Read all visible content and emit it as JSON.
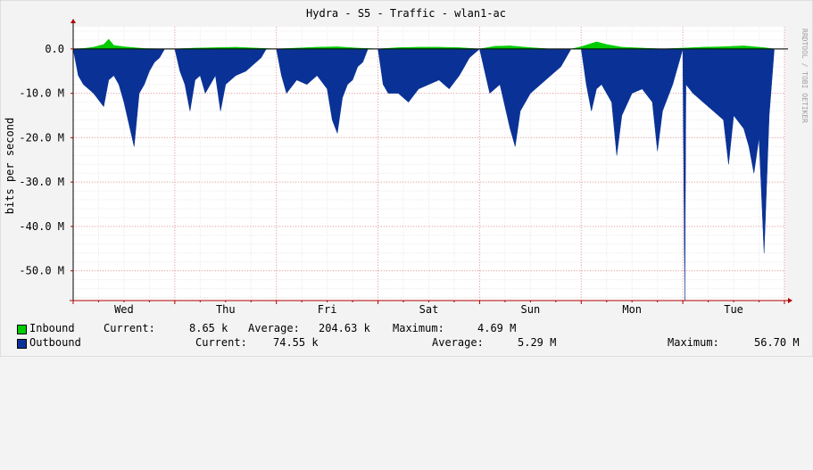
{
  "chart_data": {
    "type": "area",
    "title": "Hydra - S5 - Traffic - wlan1-ac",
    "ylabel": "bits per second",
    "watermark": "RRDTOOL / TOBI OETIKER",
    "x_ticks": [
      "Wed",
      "Thu",
      "Fri",
      "Sat",
      "Sun",
      "Mon",
      "Tue"
    ],
    "x_range_days": [
      0,
      7
    ],
    "y_ticks": [
      {
        "value": 0,
        "label": "0.0"
      },
      {
        "value": -10,
        "label": "-10.0 M"
      },
      {
        "value": -20,
        "label": "-20.0 M"
      },
      {
        "value": -30,
        "label": "-30.0 M"
      },
      {
        "value": -40,
        "label": "-40.0 M"
      },
      {
        "value": -50,
        "label": "-50.0 M"
      }
    ],
    "y_unit": "M",
    "ylim": [
      -56.7,
      5
    ],
    "grid": true,
    "colors": {
      "inbound": "#00cc00",
      "outbound": "#0a3296",
      "grid_minor": "#ececec",
      "grid_major": "#f0a0a0",
      "axis": "#b00000",
      "plot_bg": "#ffffff",
      "page_bg": "#f3f3f3"
    },
    "series": [
      {
        "name": "Inbound",
        "x": [
          0.0,
          0.1,
          0.2,
          0.3,
          0.35,
          0.4,
          0.5,
          0.6,
          0.7,
          0.9,
          1.0,
          1.2,
          1.4,
          1.6,
          1.8,
          2.0,
          2.2,
          2.4,
          2.6,
          2.8,
          3.0,
          3.2,
          3.4,
          3.6,
          3.8,
          4.0,
          4.15,
          4.3,
          4.5,
          4.7,
          4.9,
          5.0,
          5.15,
          5.25,
          5.4,
          5.6,
          5.8,
          6.0,
          6.2,
          6.4,
          6.6,
          6.8,
          6.9,
          7.0
        ],
        "values": [
          0,
          0.1,
          0.4,
          1.0,
          2.2,
          0.8,
          0.5,
          0.3,
          0.1,
          0,
          0,
          0.2,
          0.3,
          0.4,
          0.2,
          0,
          0.2,
          0.4,
          0.5,
          0.2,
          0,
          0.3,
          0.4,
          0.4,
          0.3,
          0,
          0.6,
          0.7,
          0.3,
          0,
          0,
          0.5,
          1.6,
          1.0,
          0.4,
          0.2,
          0,
          0.2,
          0.4,
          0.5,
          0.7,
          0.3,
          0,
          0
        ]
      },
      {
        "name": "Outbound",
        "x": [
          0.0,
          0.05,
          0.1,
          0.2,
          0.3,
          0.35,
          0.4,
          0.45,
          0.5,
          0.55,
          0.6,
          0.65,
          0.7,
          0.75,
          0.8,
          0.85,
          0.9,
          1.0,
          1.05,
          1.1,
          1.15,
          1.2,
          1.25,
          1.3,
          1.4,
          1.45,
          1.5,
          1.6,
          1.7,
          1.8,
          1.85,
          1.9,
          2.0,
          2.05,
          2.1,
          2.2,
          2.3,
          2.4,
          2.5,
          2.55,
          2.6,
          2.65,
          2.7,
          2.75,
          2.8,
          2.85,
          2.9,
          3.0,
          3.05,
          3.1,
          3.2,
          3.3,
          3.4,
          3.5,
          3.6,
          3.7,
          3.8,
          3.85,
          3.9,
          4.0,
          4.05,
          4.1,
          4.2,
          4.3,
          4.35,
          4.4,
          4.5,
          4.6,
          4.7,
          4.8,
          4.9,
          5.0,
          5.05,
          5.1,
          5.15,
          5.2,
          5.3,
          5.35,
          5.4,
          5.5,
          5.6,
          5.7,
          5.75,
          5.8,
          5.9,
          6.0,
          6.02,
          6.03,
          6.1,
          6.2,
          6.3,
          6.4,
          6.45,
          6.5,
          6.6,
          6.65,
          6.7,
          6.75,
          6.8,
          6.85,
          6.9,
          7.0
        ],
        "values": [
          0,
          -6,
          -8,
          -10,
          -13,
          -7,
          -6,
          -8,
          -12,
          -17,
          -22,
          -10,
          -8,
          -5,
          -3,
          -2,
          0,
          0,
          -5,
          -8,
          -14,
          -7,
          -6,
          -10,
          -6,
          -14,
          -8,
          -6,
          -5,
          -3,
          -2,
          0,
          0,
          -6,
          -10,
          -7,
          -8,
          -6,
          -9,
          -16,
          -19,
          -11,
          -8,
          -7,
          -4,
          -3,
          0,
          0,
          -8,
          -10,
          -10,
          -12,
          -9,
          -8,
          -7,
          -9,
          -6,
          -4,
          -2,
          0,
          -5,
          -10,
          -8,
          -18,
          -22,
          -14,
          -10,
          -8,
          -6,
          -4,
          0,
          0,
          -8,
          -14,
          -9,
          -8,
          -12,
          -24,
          -15,
          -10,
          -9,
          -12,
          -23,
          -14,
          -8,
          0,
          -56.7,
          -8,
          -10,
          -12,
          -14,
          -16,
          -26,
          -15,
          -18,
          -22,
          -28,
          -20,
          -46,
          -15,
          0,
          0
        ]
      }
    ]
  },
  "legend": {
    "inbound": {
      "name": "Inbound",
      "current_label": "Current:",
      "current": "8.65 k",
      "average_label": "Average:",
      "average": "204.63 k",
      "maximum_label": "Maximum:",
      "maximum": "4.69 M"
    },
    "outbound": {
      "name": "Outbound",
      "current_label": "Current:",
      "current": "74.55 k",
      "average_label": "Average:",
      "average": "5.29 M",
      "maximum_label": "Maximum:",
      "maximum": "56.70 M"
    }
  }
}
